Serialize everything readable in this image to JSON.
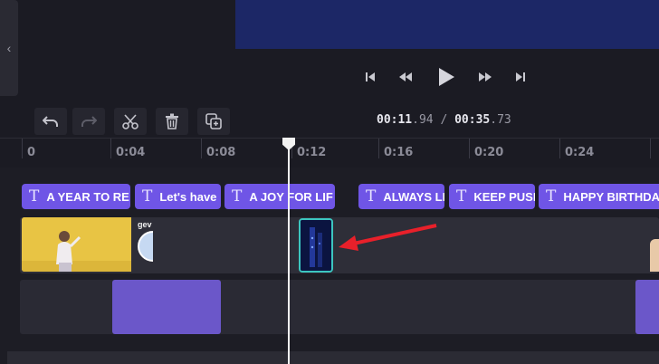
{
  "player": {
    "collapse_icon": "chevron-left-icon",
    "controls": [
      "skip-back-icon",
      "rewind-icon",
      "play-icon",
      "fast-forward-icon",
      "skip-forward-icon"
    ]
  },
  "toolbar": {
    "tools": [
      "undo-icon",
      "redo-icon",
      "split-icon",
      "delete-icon",
      "duplicate-icon"
    ],
    "time_current_main": "00:11",
    "time_current_frac": ".94",
    "time_separator": " / ",
    "time_total_main": "00:35",
    "time_total_frac": ".73"
  },
  "ruler": {
    "labels": [
      "0",
      "0:04",
      "0:08",
      "0:12",
      "0:16",
      "0:20",
      "0:24"
    ]
  },
  "text_track": {
    "icon_glyph": "T",
    "clips": [
      {
        "label": "A YEAR TO RE"
      },
      {
        "label": "Let's have"
      },
      {
        "label": "A JOY FOR LIF"
      },
      {
        "label": "ALWAYS LI"
      },
      {
        "label": "KEEP PUSH"
      },
      {
        "label": "HAPPY BIRTHDA"
      }
    ]
  },
  "video_track": {
    "thumb2_text": "gev"
  },
  "colors": {
    "accent": "#6f55e6",
    "selected_border": "#3cc6c0",
    "arrow": "#e8202a",
    "video_frame": "#1c2766"
  }
}
